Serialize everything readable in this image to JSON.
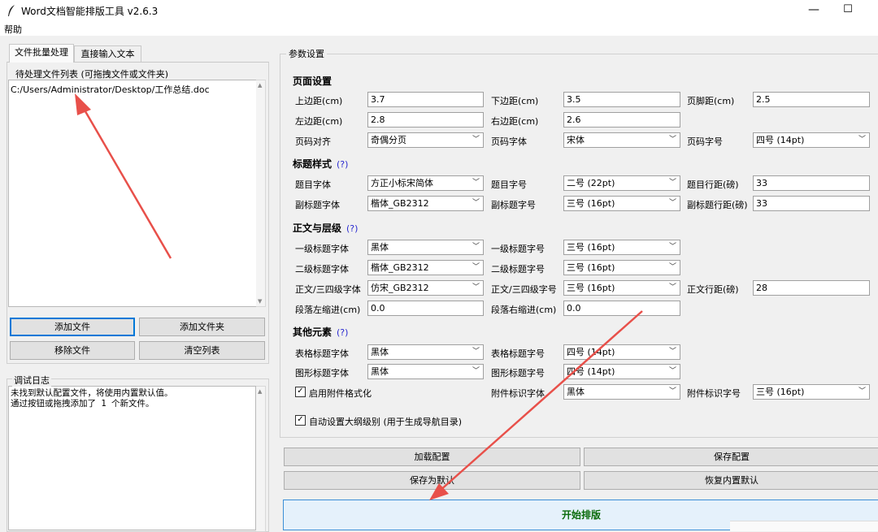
{
  "window": {
    "title": "Word文档智能排版工具 v2.6.3",
    "min": "—",
    "max": "☐"
  },
  "menu": {
    "help": "帮助"
  },
  "tabs": [
    "文件批量处理",
    "直接输入文本"
  ],
  "filelist": {
    "label": "待处理文件列表 (可拖拽文件或文件夹)",
    "items": [
      "C:/Users/Administrator/Desktop/工作总结.doc"
    ]
  },
  "file_buttons": {
    "add_file": "添加文件",
    "add_folder": "添加文件夹",
    "remove_file": "移除文件",
    "clear_list": "清空列表"
  },
  "log": {
    "label": "调试日志",
    "text": "未找到默认配置文件，将使用内置默认值。\n通过按钮或拖拽添加了 1 个新文件。"
  },
  "params": {
    "label": "参数设置",
    "page": {
      "title": "页面设置",
      "top_margin_label": "上边距(cm)",
      "top_margin": "3.7",
      "bottom_margin_label": "下边距(cm)",
      "bottom_margin": "3.5",
      "footer_label": "页脚距(cm)",
      "footer": "2.5",
      "left_margin_label": "左边距(cm)",
      "left_margin": "2.8",
      "right_margin_label": "右边距(cm)",
      "right_margin": "2.6",
      "pn_align_label": "页码对齐",
      "pn_align": "奇偶分页",
      "pn_font_label": "页码字体",
      "pn_font": "宋体",
      "pn_size_label": "页码字号",
      "pn_size": "四号 (14pt)"
    },
    "title_style": {
      "title": "标题样式",
      "help": "(?)",
      "t_font_label": "题目字体",
      "t_font": "方正小标宋简体",
      "t_size_label": "题目字号",
      "t_size": "二号 (22pt)",
      "t_spacing_label": "题目行距(磅)",
      "t_spacing": "33",
      "st_font_label": "副标题字体",
      "st_font": "楷体_GB2312",
      "st_size_label": "副标题字号",
      "st_size": "三号 (16pt)",
      "st_spacing_label": "副标题行距(磅)",
      "st_spacing": "33"
    },
    "body": {
      "title": "正文与层级",
      "help": "(?)",
      "h1_font_label": "一级标题字体",
      "h1_font": "黑体",
      "h1_size_label": "一级标题字号",
      "h1_size": "三号 (16pt)",
      "h2_font_label": "二级标题字体",
      "h2_font": "楷体_GB2312",
      "h2_size_label": "二级标题字号",
      "h2_size": "三号 (16pt)",
      "body_font_label": "正文/三四级字体",
      "body_font": "仿宋_GB2312",
      "body_size_label": "正文/三四级字号",
      "body_size": "三号 (16pt)",
      "body_spacing_label": "正文行距(磅)",
      "body_spacing": "28",
      "left_indent_label": "段落左缩进(cm)",
      "left_indent": "0.0",
      "right_indent_label": "段落右缩进(cm)",
      "right_indent": "0.0"
    },
    "other": {
      "title": "其他元素",
      "help": "(?)",
      "table_font_label": "表格标题字体",
      "table_font": "黑体",
      "table_size_label": "表格标题字号",
      "table_size": "四号 (14pt)",
      "fig_font_label": "图形标题字体",
      "fig_font": "黑体",
      "fig_size_label": "图形标题字号",
      "fig_size": "四号 (14pt)",
      "attach_enable_label": "启用附件格式化",
      "attach_font_label": "附件标识字体",
      "attach_font": "黑体",
      "attach_size_label": "附件标识字号",
      "attach_size": "三号 (16pt)",
      "outline_label": "自动设置大纲级别 (用于生成导航目录)"
    }
  },
  "actions": {
    "load": "加载配置",
    "save": "保存配置",
    "save_default": "保存为默认",
    "restore_default": "恢复内置默认",
    "start": "开始排版"
  },
  "colors": {
    "annotation_arrow": "#e8504a",
    "help_link": "#2a2ad0",
    "start_text": "#0a6b0a"
  }
}
